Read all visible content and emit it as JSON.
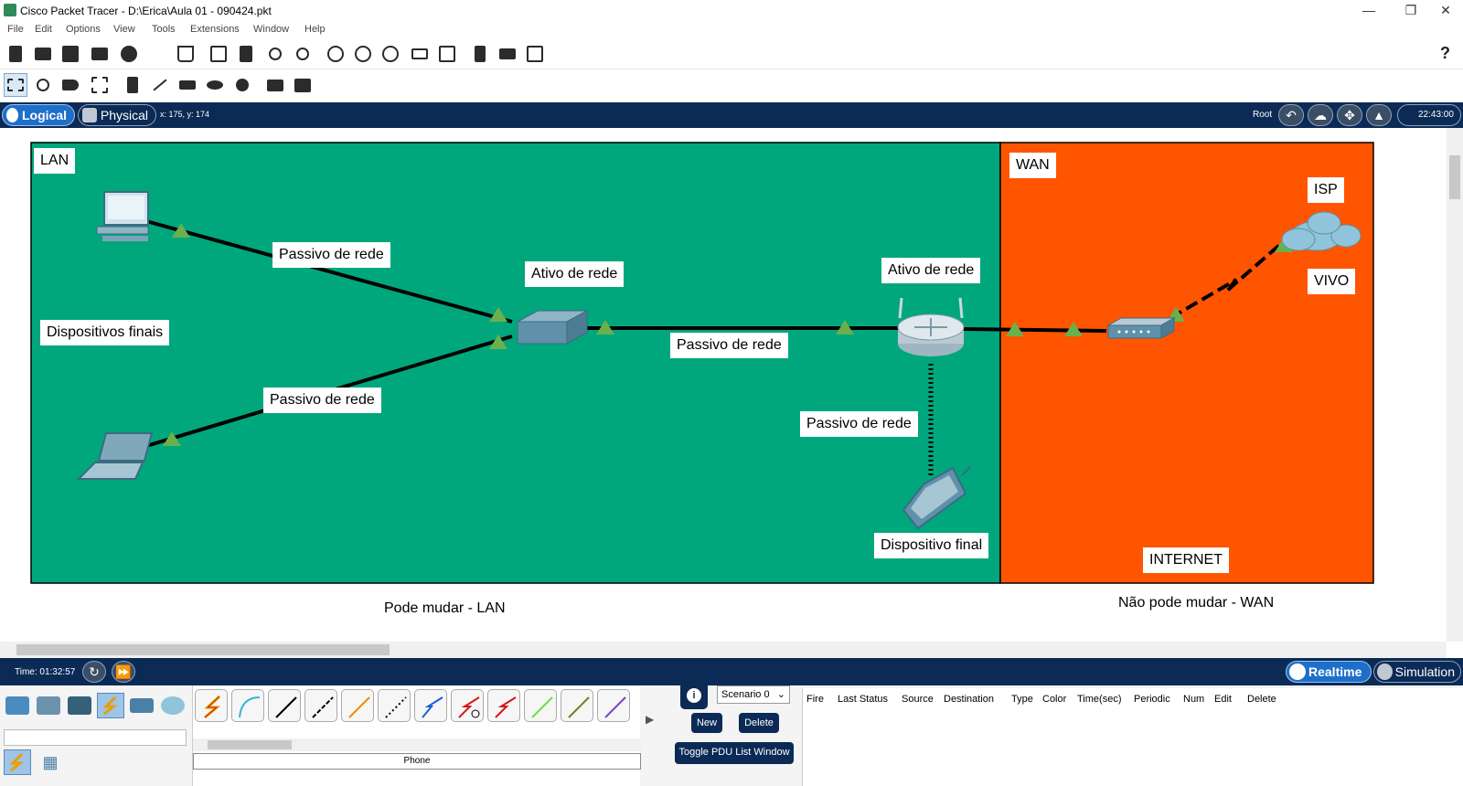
{
  "window": {
    "title": "Cisco Packet Tracer - D:\\Erica\\Aula 01 - 090424.pkt"
  },
  "menu": [
    "File",
    "Edit",
    "Options",
    "View",
    "Tools",
    "Extensions",
    "Window",
    "Help"
  ],
  "toolbar1": {
    "icons": [
      "new-file-icon",
      "open-folder-icon",
      "save-icon",
      "print-icon",
      "info-icon",
      "activity-wizard-icon",
      "copy-icon",
      "paste-icon",
      "undo-icon",
      "redo-icon",
      "zoom-in-icon",
      "zoom-reset-icon",
      "zoom-out-icon",
      "drawing-palette-icon",
      "custom-devices-icon",
      "pdu-icon",
      "device-template-icon",
      "screenshot-icon"
    ],
    "help_label": "?"
  },
  "toolbar2": {
    "icons": [
      "select-icon",
      "inspect-icon",
      "delete-icon",
      "resize-icon",
      "note-icon",
      "line-icon",
      "rectangle-icon",
      "ellipse-icon",
      "freeform-icon",
      "simple-pdu-icon",
      "complex-pdu-icon"
    ]
  },
  "navbar": {
    "logical": "Logical",
    "physical": "Physical",
    "coords": "x: 175, y: 174",
    "root": "Root",
    "time": "22:43:00"
  },
  "workspace": {
    "lan_label": "LAN",
    "wan_label": "WAN",
    "isp_label": "ISP",
    "vivo_label": "VIVO",
    "internet_label": "INTERNET",
    "end_devices_label": "Dispositivos finais",
    "passive_top": "Passivo de rede",
    "passive_bottom": "Passivo de rede",
    "passive_middle": "Passivo de rede",
    "passive_right": "Passivo de rede",
    "active_switch": "Ativo de rede",
    "active_router": "Ativo de rede",
    "end_device": "Dispositivo final",
    "lan_caption": "Pode mudar - LAN",
    "wan_caption": "Não pode mudar - WAN"
  },
  "colors": {
    "lan": "#00a77d",
    "wan": "#ff5500",
    "nav": "#0b2a55",
    "link_light": "#6ab04c"
  },
  "realtime": {
    "time": "Time: 01:32:57",
    "realtime": "Realtime",
    "simulation": "Simulation"
  },
  "bottom": {
    "device_label": "Phone",
    "scenario": "Scenario 0",
    "new": "New",
    "delete": "Delete",
    "toggle": "Toggle PDU List Window",
    "columns": [
      "Fire",
      "Last Status",
      "Source",
      "Destination",
      "Type",
      "Color",
      "Time(sec)",
      "Periodic",
      "Num",
      "Edit",
      "Delete"
    ]
  }
}
